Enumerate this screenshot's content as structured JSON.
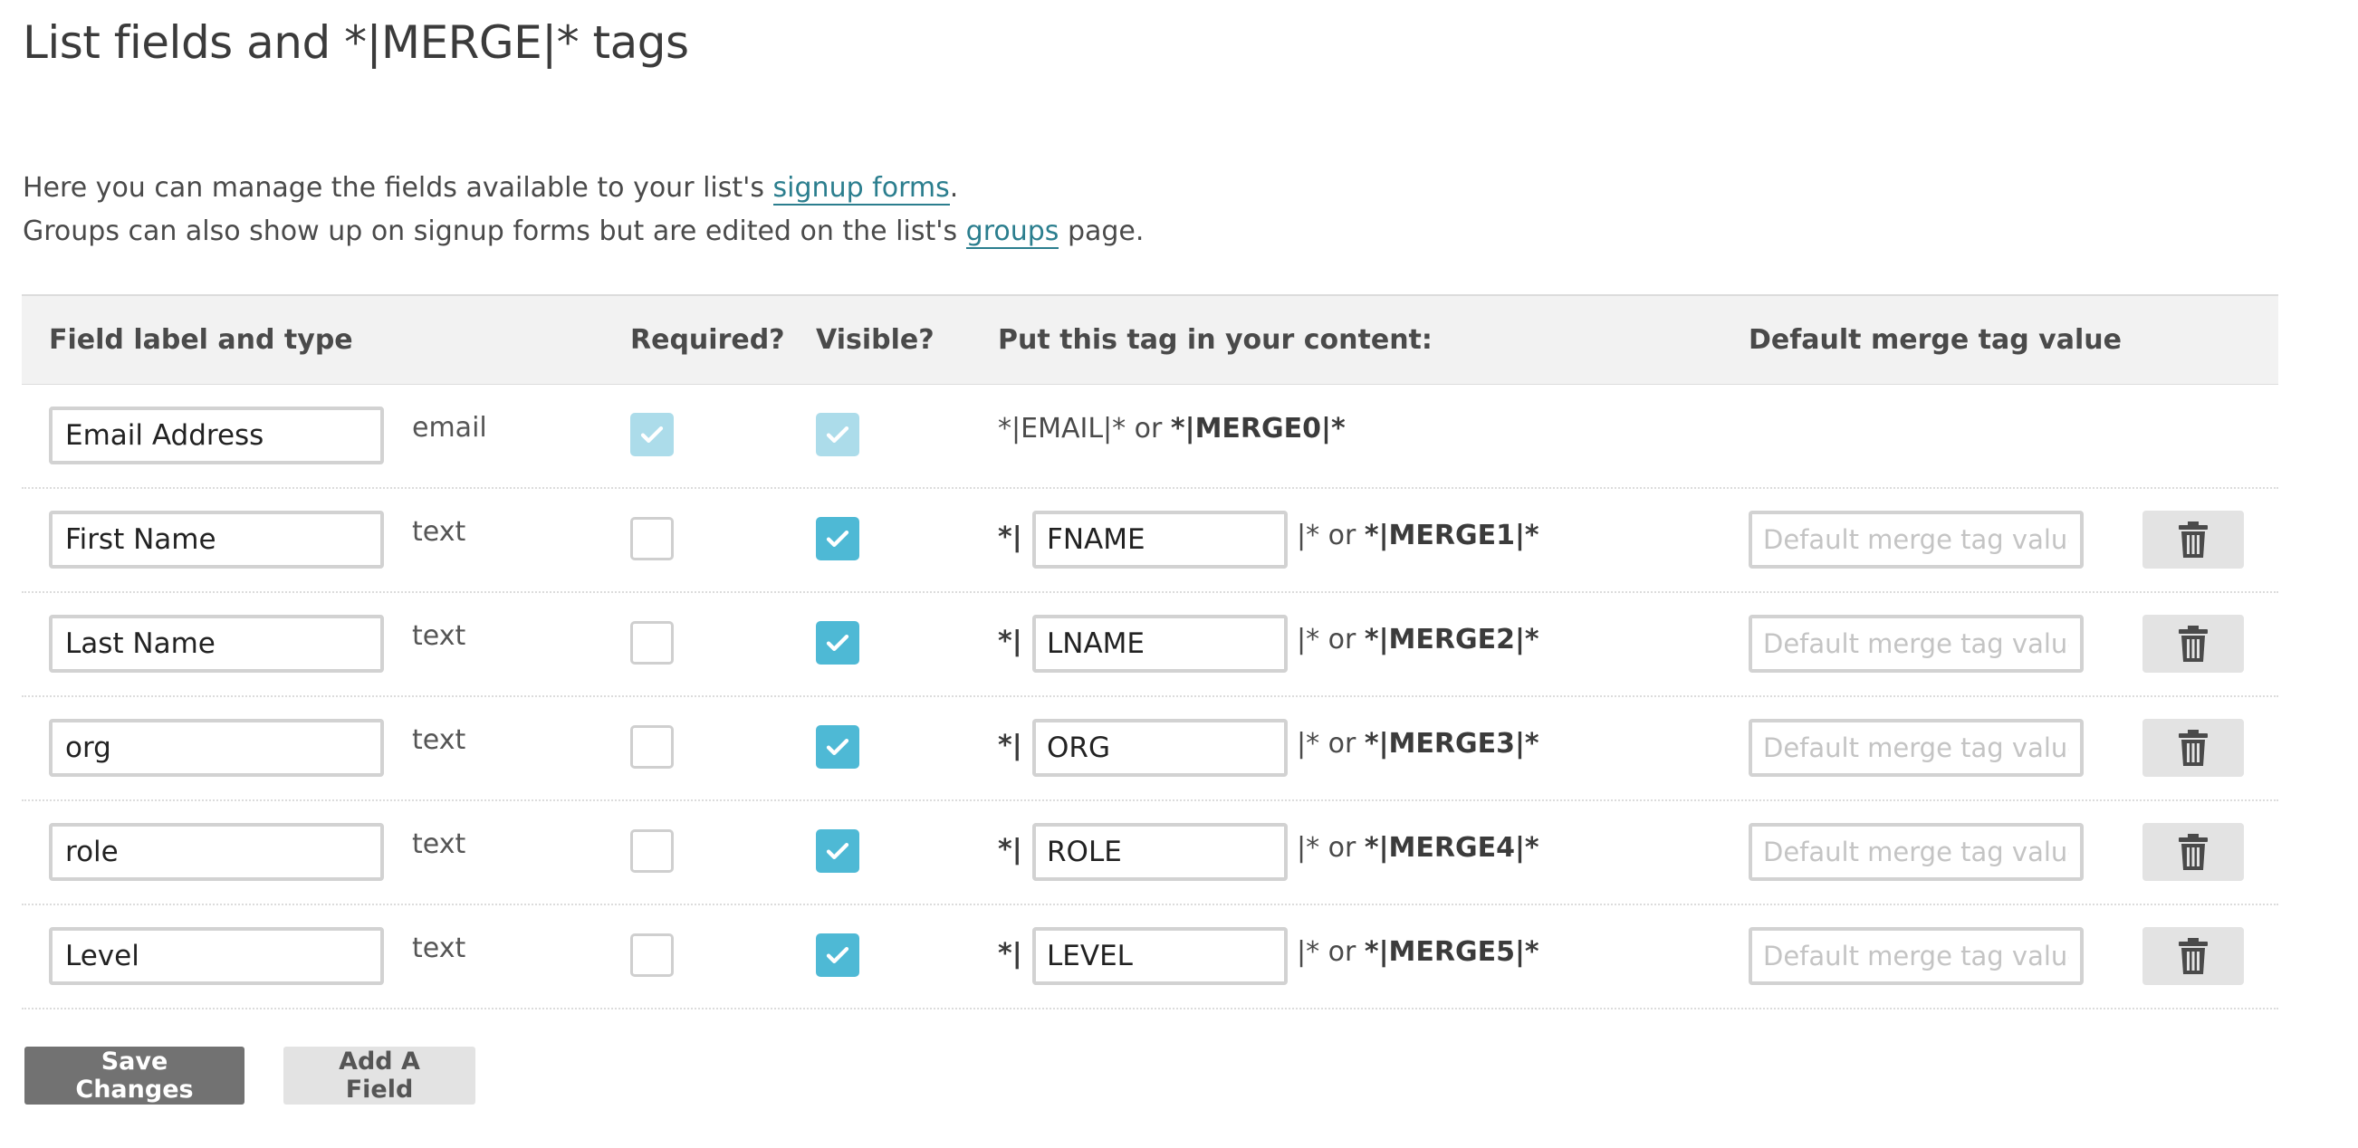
{
  "page": {
    "title": "List fields and *|MERGE|* tags",
    "intro": {
      "line1_prefix": "Here you can manage the fields available to your list's ",
      "line1_link": "signup forms",
      "line1_suffix": ".",
      "line2_prefix": "Groups can also show up on signup forms but are edited on the list's ",
      "line2_link": "groups",
      "line2_suffix": " page."
    }
  },
  "table": {
    "headers": {
      "label": "Field label and type",
      "required": "Required?",
      "visible": "Visible?",
      "tag": "Put this tag in your content:",
      "default": "Default merge tag value"
    },
    "email_row": {
      "label": "Email Address",
      "type": "email",
      "tag_text": "*|EMAIL|* or ",
      "tag_merge": "*|MERGE0|*"
    },
    "rows": [
      {
        "label": "First Name",
        "type": "text",
        "required": false,
        "visible": true,
        "tag_prefix": "*|",
        "tag": "FNAME",
        "tag_or": "|* or ",
        "merge": "*|MERGE1|*",
        "default_placeholder": "Default merge tag value"
      },
      {
        "label": "Last Name",
        "type": "text",
        "required": false,
        "visible": true,
        "tag_prefix": "*|",
        "tag": "LNAME",
        "tag_or": "|* or ",
        "merge": "*|MERGE2|*",
        "default_placeholder": "Default merge tag value"
      },
      {
        "label": "org",
        "type": "text",
        "required": false,
        "visible": true,
        "tag_prefix": "*|",
        "tag": "ORG",
        "tag_or": "|* or ",
        "merge": "*|MERGE3|*",
        "default_placeholder": "Default merge tag value"
      },
      {
        "label": "role",
        "type": "text",
        "required": false,
        "visible": true,
        "tag_prefix": "*|",
        "tag": "ROLE",
        "tag_or": "|* or ",
        "merge": "*|MERGE4|*",
        "default_placeholder": "Default merge tag value"
      },
      {
        "label": "Level",
        "type": "text",
        "required": false,
        "visible": true,
        "tag_prefix": "*|",
        "tag": "LEVEL",
        "tag_or": "|* or ",
        "merge": "*|MERGE5|*",
        "default_placeholder": "Default merge tag value"
      }
    ]
  },
  "buttons": {
    "save": "Save Changes",
    "add": "Add A Field"
  },
  "icons": {
    "checkmark": "checkmark-icon",
    "trash": "trash-icon"
  },
  "colors": {
    "accent": "#4eb9d5",
    "accent_disabled": "#acdcea",
    "link": "#2b7e8e",
    "save_button": "#727272",
    "secondary_button": "#e3e3e3"
  }
}
